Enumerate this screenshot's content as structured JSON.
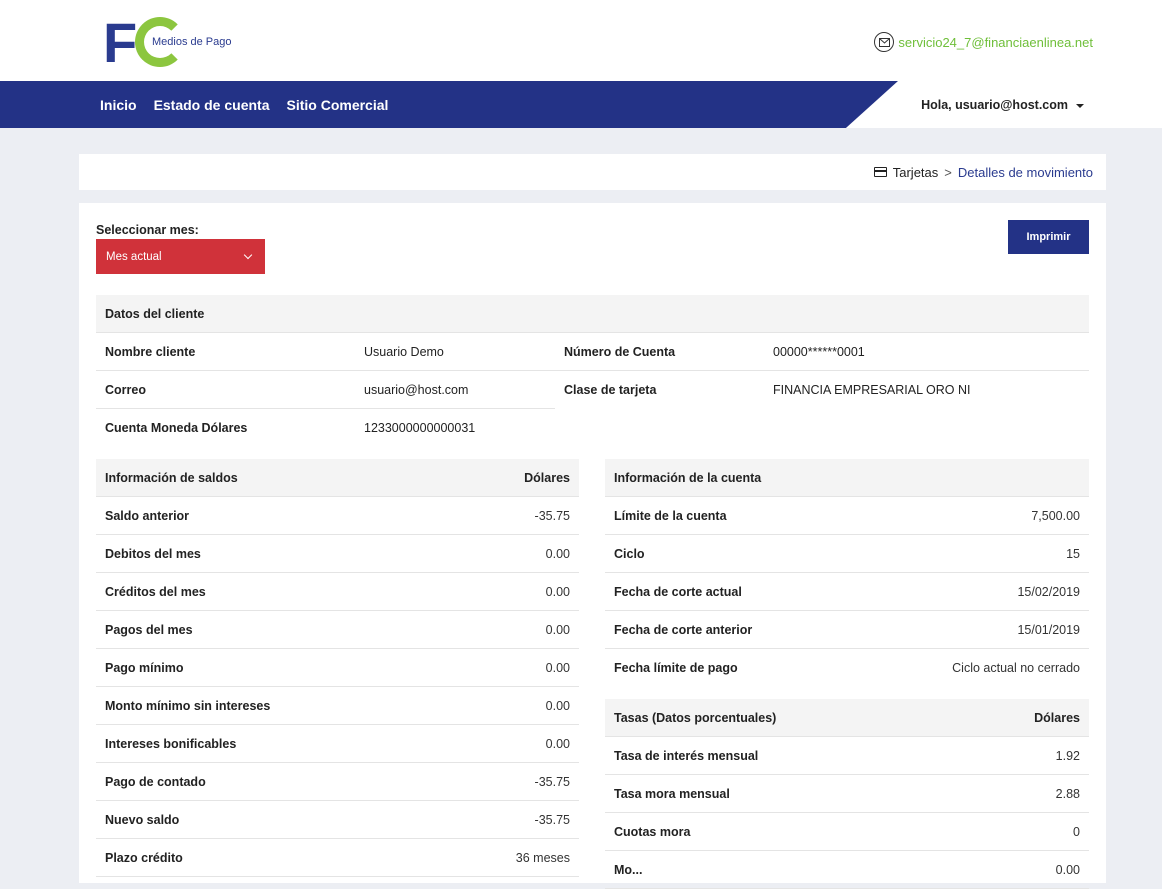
{
  "header": {
    "logo_subtitle": "Medios de Pago",
    "email": "servicio24_7@financiaenlinea.net"
  },
  "nav": {
    "items": [
      {
        "label": "Inicio"
      },
      {
        "label": "Estado de cuenta"
      },
      {
        "label": "Sitio Comercial"
      }
    ],
    "user_greeting": "Hola, usuario@host.com"
  },
  "breadcrumb": {
    "parent": "Tarjetas",
    "separator": ">",
    "current": "Detalles de movimiento"
  },
  "controls": {
    "month_label": "Seleccionar mes:",
    "month_selected": "Mes actual",
    "print_label": "Imprimir"
  },
  "client": {
    "title": "Datos del cliente",
    "name_label": "Nombre cliente",
    "name_value": "Usuario Demo",
    "account_label": "Número de Cuenta",
    "account_value": "00000******0001",
    "email_label": "Correo",
    "email_value": "usuario@host.com",
    "card_class_label": "Clase de tarjeta",
    "card_class_value": "FINANCIA EMPRESARIAL ORO NI",
    "dollar_account_label": "Cuenta Moneda Dólares",
    "dollar_account_value": "1233000000000031"
  },
  "balances": {
    "title": "Información de saldos",
    "currency": "Dólares",
    "rows": [
      {
        "label": "Saldo anterior",
        "value": "-35.75"
      },
      {
        "label": "Debitos del mes",
        "value": "0.00"
      },
      {
        "label": "Créditos del mes",
        "value": "0.00"
      },
      {
        "label": "Pagos del mes",
        "value": "0.00"
      },
      {
        "label": "Pago mínimo",
        "value": "0.00"
      },
      {
        "label": "Monto mínimo sin intereses",
        "value": "0.00"
      },
      {
        "label": "Intereses bonificables",
        "value": "0.00"
      },
      {
        "label": "Pago de contado",
        "value": "-35.75"
      },
      {
        "label": "Nuevo saldo",
        "value": "-35.75"
      },
      {
        "label": "Plazo crédito",
        "value": "36 meses"
      }
    ]
  },
  "account_info": {
    "title": "Información de la cuenta",
    "rows": [
      {
        "label": "Límite de la cuenta",
        "value": "7,500.00"
      },
      {
        "label": "Ciclo",
        "value": "15"
      },
      {
        "label": "Fecha de corte actual",
        "value": "15/02/2019"
      },
      {
        "label": "Fecha de corte anterior",
        "value": "15/01/2019"
      },
      {
        "label": "Fecha límite de pago",
        "value": "Ciclo actual no cerrado"
      }
    ]
  },
  "rates": {
    "title": "Tasas (Datos porcentuales)",
    "currency": "Dólares",
    "rows": [
      {
        "label": "Tasa de interés mensual",
        "value": "1.92"
      },
      {
        "label": "Tasa mora mensual",
        "value": "2.88"
      },
      {
        "label": "Cuotas mora",
        "value": "0"
      },
      {
        "label": "Mo...",
        "value": "0.00"
      }
    ]
  },
  "colors": {
    "brand_blue": "#233286",
    "brand_green": "#8cc63f",
    "select_red": "#d0323a"
  }
}
